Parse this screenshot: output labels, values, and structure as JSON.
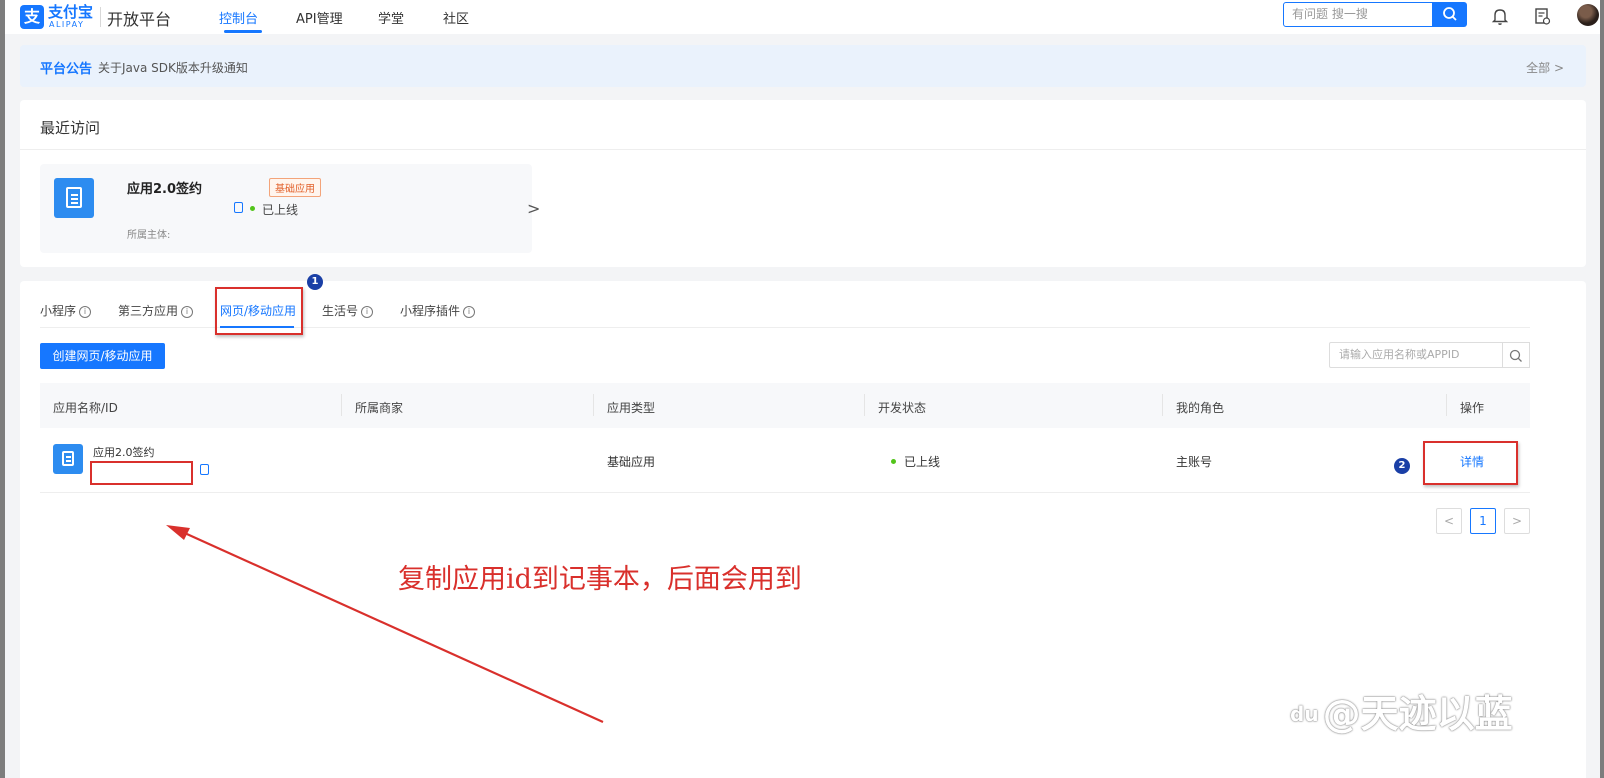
{
  "topnav": {
    "logo_glyph": "支",
    "logo_cn": "支付宝",
    "logo_en": "ALIPAY",
    "brand": "开放平台",
    "items": [
      {
        "label": "控制台",
        "active": true
      },
      {
        "label": "API管理",
        "active": false
      },
      {
        "label": "学堂",
        "active": false
      },
      {
        "label": "社区",
        "active": false
      }
    ],
    "search_placeholder": "有问题 搜一搜",
    "icons": [
      "bell-icon",
      "document-icon"
    ]
  },
  "notice": {
    "label": "平台公告",
    "text": "关于Java SDK版本升级通知",
    "all": "全部 >"
  },
  "recent": {
    "title": "最近访问",
    "card": {
      "name": "应用2.0签约",
      "tag": "基础应用",
      "status": "已上线",
      "owner_label": "所属主体:",
      "arrow": ">"
    }
  },
  "apps": {
    "tabs": [
      {
        "label": "小程序",
        "info": true,
        "active": false
      },
      {
        "label": "第三方应用",
        "info": true,
        "active": false
      },
      {
        "label": "网页/移动应用",
        "info": false,
        "active": true
      },
      {
        "label": "生活号",
        "info": true,
        "active": false
      },
      {
        "label": "小程序插件",
        "info": true,
        "active": false
      }
    ],
    "create_label": "创建网页/移动应用",
    "search_placeholder": "请输入应用名称或APPID",
    "columns": [
      "应用名称/ID",
      "所属商家",
      "应用类型",
      "开发状态",
      "我的角色",
      "操作"
    ],
    "rows": [
      {
        "name": "应用2.0签约",
        "merchant": "",
        "type": "基础应用",
        "status": "已上线",
        "role": "主账号",
        "action": "详情"
      }
    ],
    "pager": {
      "prev": "<",
      "current": "1",
      "next": ">"
    }
  },
  "markers": {
    "one": "1",
    "two": "2"
  },
  "annotation": "复制应用id到记事本，后面会用到",
  "watermark": "@天迹以蓝",
  "watermark_logo": "du",
  "colors": {
    "primary": "#1677ff",
    "annotation_red": "#d9302c",
    "online_green": "#52c41a",
    "tag_orange": "#e2612b"
  }
}
